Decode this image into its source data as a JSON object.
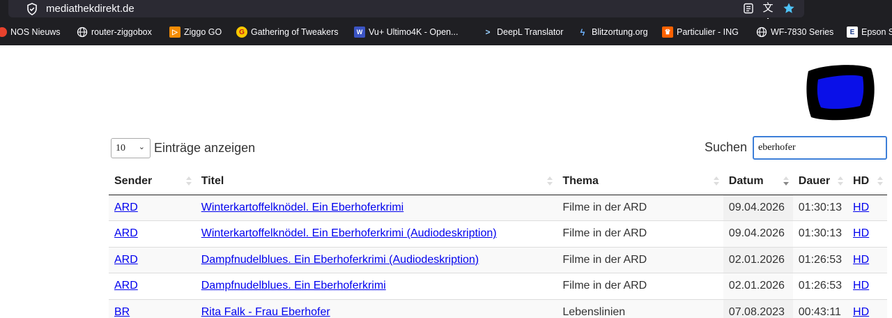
{
  "browser": {
    "url": "mediathekdirekt.de",
    "bookmarks": [
      {
        "label": "NOS Nieuws",
        "icon": "nos-icon",
        "color": "#e8422d"
      },
      {
        "label": "router-ziggobox",
        "icon": "globe-icon",
        "color": ""
      },
      {
        "label": "Ziggo GO",
        "icon": "ziggo-icon",
        "color": "#f48c06"
      },
      {
        "label": "Gathering of Tweakers",
        "icon": "tweakers-icon",
        "color": "#f9c800"
      },
      {
        "label": "Vu+ Ultimo4K - Open...",
        "icon": "vuplus-icon",
        "color": "#3b54c4"
      },
      {
        "label": "DeepL Translator",
        "icon": "deepl-icon",
        "color": ""
      },
      {
        "label": "Blitzortung.org",
        "icon": "blitzortung-icon",
        "color": ""
      },
      {
        "label": "Particulier - ING",
        "icon": "ing-icon",
        "color": "#ff6200"
      },
      {
        "label": "WF-7830 Series",
        "icon": "globe-icon",
        "color": ""
      },
      {
        "label": "Epson S",
        "icon": "epson-icon",
        "color": "#ffffff"
      }
    ]
  },
  "controls": {
    "length_value": "10",
    "length_label": "Einträge anzeigen",
    "search_label": "Suchen",
    "search_value": "eberhofer"
  },
  "table": {
    "columns": [
      "Sender",
      "Titel",
      "Thema",
      "Datum",
      "Dauer",
      "HD"
    ],
    "sorted_column": "Datum",
    "rows": [
      {
        "sender": "ARD",
        "titel": "Winterkartoffelknödel. Ein Eberhoferkrimi",
        "thema": "Filme in der ARD",
        "datum": "09.04.2026",
        "dauer": "01:30:13",
        "hd": "HD"
      },
      {
        "sender": "ARD",
        "titel": "Winterkartoffelknödel. Ein Eberhoferkrimi (Audiodeskription)",
        "thema": "Filme in der ARD",
        "datum": "09.04.2026",
        "dauer": "01:30:13",
        "hd": "HD"
      },
      {
        "sender": "ARD",
        "titel": "Dampfnudelblues. Ein Eberhoferkrimi (Audiodeskription)",
        "thema": "Filme in der ARD",
        "datum": "02.01.2026",
        "dauer": "01:26:53",
        "hd": "HD"
      },
      {
        "sender": "ARD",
        "titel": "Dampfnudelblues. Ein Eberhoferkrimi",
        "thema": "Filme in der ARD",
        "datum": "02.01.2026",
        "dauer": "01:26:53",
        "hd": "HD"
      },
      {
        "sender": "BR",
        "titel": "Rita Falk - Frau Eberhofer",
        "thema": "Lebenslinien",
        "datum": "07.08.2023",
        "dauer": "00:43:11",
        "hd": "HD"
      }
    ]
  },
  "colors": {
    "link": "#0000ee",
    "logo_screen": "#0a10e8",
    "search_focus": "#3d7fd8"
  }
}
